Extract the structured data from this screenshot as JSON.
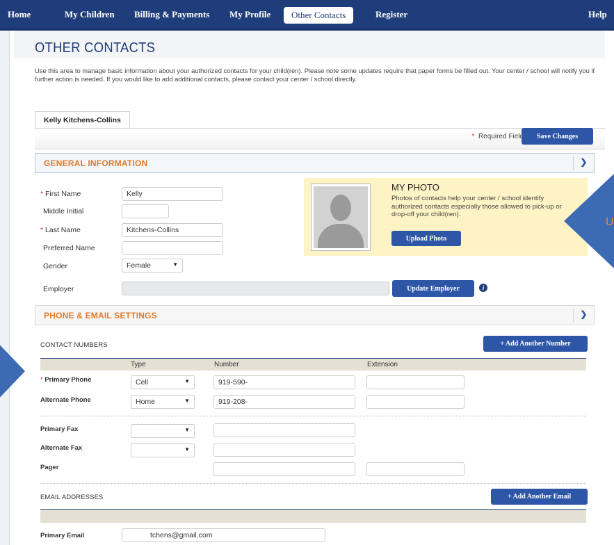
{
  "nav": {
    "items": [
      "Home",
      "My Children",
      "Billing & Payments",
      "My Profile",
      "Other Contacts",
      "Register"
    ],
    "help": "Help",
    "active": "Other Contacts"
  },
  "page": {
    "title": "OTHER CONTACTS",
    "intro": "Use this area to manage basic information about your authorized contacts for your child(ren). Please note some updates require that paper forms be filled out. Your center / school will notify you if further action is needed. If you would like to add additional contacts, please contact your center / school directly.",
    "tab": "Kelly Kitchens-Collins",
    "required_fields": "Required Fields",
    "save_button": "Save Changes"
  },
  "general": {
    "header": "GENERAL INFORMATION",
    "first_name_label": "First Name",
    "first_name": "Kelly",
    "middle_initial_label": "Middle Initial",
    "middle_initial": "",
    "last_name_label": "Last Name",
    "last_name": "Kitchens-Collins",
    "preferred_name_label": "Preferred Name",
    "preferred_name": "",
    "gender_label": "Gender",
    "gender": "Female",
    "employer_label": "Employer",
    "employer": "",
    "update_employer_button": "Update Employer"
  },
  "photo": {
    "title": "MY PHOTO",
    "text": "Photos of contacts help your center / school identify authorized contacts especially those allowed to pick-up or drop-off your child(ren).",
    "upload_button": "Upload Photo"
  },
  "phone_email": {
    "header": "PHONE & EMAIL SETTINGS",
    "contact_numbers_label": "CONTACT NUMBERS",
    "add_number_button": "+ Add Another Number",
    "columns": [
      "Type",
      "Number",
      "Extension"
    ],
    "rows": [
      {
        "label": "Primary Phone",
        "required": true,
        "type": "Cell",
        "number": "919-590-",
        "extension": ""
      },
      {
        "label": "Alternate Phone",
        "required": false,
        "type": "Home",
        "number": "919-208-",
        "extension": ""
      },
      {
        "label": "Primary Fax",
        "required": false,
        "type": "",
        "number": "",
        "extension": null
      },
      {
        "label": "Alternate Fax",
        "required": false,
        "type": "",
        "number": "",
        "extension": null
      },
      {
        "label": "Pager",
        "required": false,
        "type": null,
        "number": "",
        "extension": ""
      }
    ],
    "email_addresses_label": "EMAIL ADDRESSES",
    "add_email_button": "+ Add Another Email",
    "primary_email_label": "Primary Email",
    "primary_email": "tchens@gmail.com"
  },
  "colors": {
    "nav": "#1f3d7a",
    "accent_button": "#2d56a7",
    "section_header_text": "#e07a29",
    "photo_box": "#fdf3c4",
    "annotation_arrow": "#3d6bb3"
  }
}
